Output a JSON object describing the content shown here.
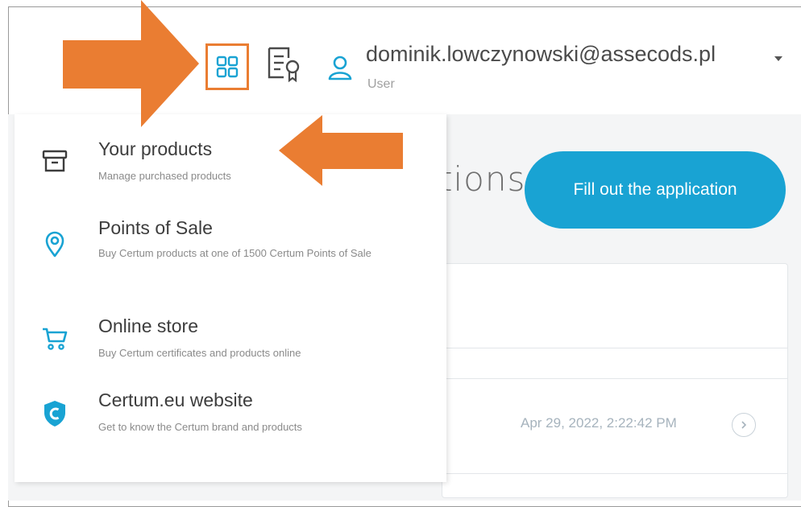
{
  "header": {
    "user_email": "dominik.lowczynowski@assecods.pl",
    "user_role": "User",
    "icons": [
      "apps-grid-icon",
      "certificate-icon",
      "user-icon",
      "caret-down-icon"
    ]
  },
  "main": {
    "title_fragment": "tions",
    "fill_button_label": "Fill out the application",
    "row_timestamp": "Apr 29, 2022, 2:22:42 PM",
    "row_icon": "chevron-right-icon"
  },
  "menu": {
    "items": [
      {
        "title": "Your products",
        "description": "Manage purchased products",
        "icon": "archive-box-icon"
      },
      {
        "title": "Points of Sale",
        "description": "Buy Certum products at one of 1500 Certum Points of Sale",
        "icon": "location-pin-icon"
      },
      {
        "title": "Online store",
        "description": "Buy Certum certificates and products online",
        "icon": "shopping-cart-icon"
      },
      {
        "title": "Certum.eu website",
        "description": "Get to know the Certum brand and products",
        "icon": "certum-shield-icon"
      }
    ]
  },
  "colors": {
    "accent": "#19a3d3",
    "annotation_orange": "#ea7d32",
    "text_dark": "#3d3d3d",
    "text_muted": "#8a8a8a"
  }
}
